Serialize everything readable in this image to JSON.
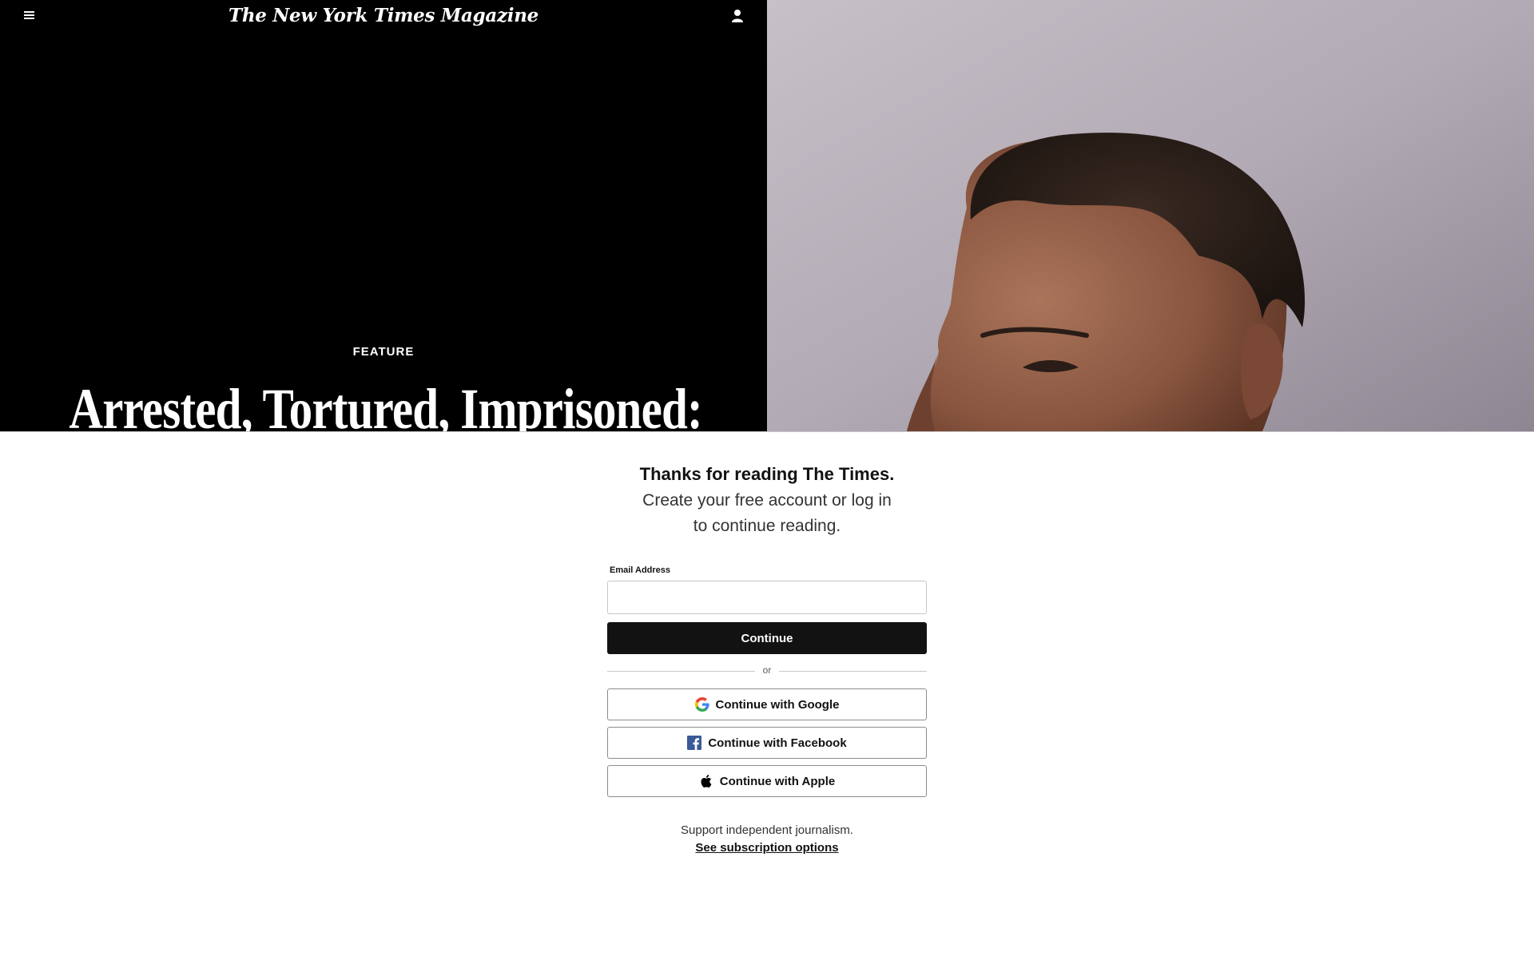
{
  "header": {
    "masthead": "The New York Times Magazine",
    "menu_icon": "hamburger-menu-icon",
    "account_icon": "user-account-icon"
  },
  "article": {
    "kicker": "FEATURE",
    "headline": "Arrested, Tortured, Imprisoned:"
  },
  "gate": {
    "title": "Thanks for reading The Times.",
    "subtitle": "Create your free account or log in to continue reading.",
    "email_label": "Email Address",
    "email_value": "",
    "continue_label": "Continue",
    "or_label": "or",
    "google_label": "Continue with Google",
    "facebook_label": "Continue with Facebook",
    "apple_label": "Continue with Apple",
    "support_text": "Support independent journalism.",
    "subscription_link": "See subscription options"
  },
  "colors": {
    "hero_left_bg": "#000000",
    "button_dark": "#121212",
    "facebook_blue": "#3b5998",
    "border": "#c7c7c7"
  }
}
